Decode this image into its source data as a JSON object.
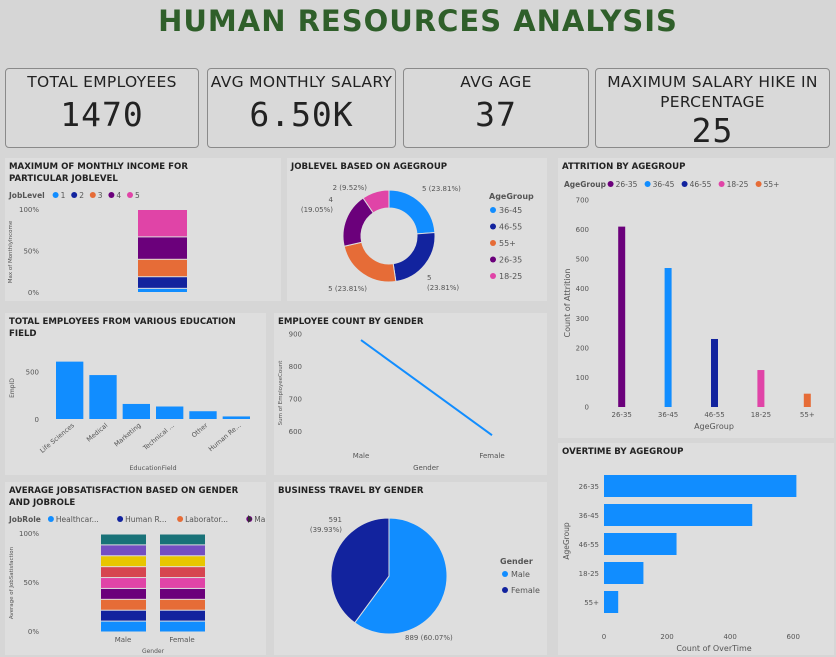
{
  "title": "HUMAN RESOURCES ANALYSIS",
  "kpis": {
    "total_employees": {
      "label": "TOTAL EMPLOYEES",
      "value": "1470"
    },
    "avg_salary": {
      "label": "AVG MONTHLY SALARY",
      "value": "6.50K"
    },
    "avg_age": {
      "label": "AVG AGE",
      "value": "37"
    },
    "max_hike": {
      "label": "MAXIMUM SALARY HIKE IN PERCENTAGE",
      "value": "25"
    }
  },
  "colors": {
    "c1": "#118dff",
    "c2": "#12239e",
    "c3": "#e66c37",
    "c4": "#6b007b",
    "c5": "#e044a7",
    "c6": "#d64550",
    "c7": "#e8c600",
    "c8": "#744ec2",
    "c9": "#197278"
  },
  "chart_data": [
    {
      "id": "jobincome",
      "type": "bar",
      "title": "MAXIMUM OF MONTHLY INCOME FOR PARTICULAR JOBLEVEL",
      "legend_title": "JobLevel",
      "categories": [
        ""
      ],
      "series": [
        {
          "name": "1",
          "values": [
            5
          ]
        },
        {
          "name": "2",
          "values": [
            14
          ]
        },
        {
          "name": "3",
          "values": [
            21
          ]
        },
        {
          "name": "4",
          "values": [
            27
          ]
        },
        {
          "name": "5",
          "values": [
            33
          ]
        }
      ],
      "ylabel": "Max of MonthlyIncome",
      "yticks": [
        "100%",
        "50%",
        "0%"
      ],
      "stacked": "100%"
    },
    {
      "id": "joblevel",
      "type": "pie",
      "variant": "donut",
      "title": "JOBLEVEL BASED ON AGEGROUP",
      "legend_title": "AgeGroup",
      "labels": [
        "36-45",
        "46-55",
        "55+",
        "26-35",
        "18-25"
      ],
      "values": [
        5,
        5,
        5,
        4,
        2
      ],
      "data_labels": [
        "5 (23.81%)",
        "5\n(23.81%)",
        "5 (23.81%)",
        "4\n(19.05%)",
        "2 (9.52%)"
      ]
    },
    {
      "id": "attrition",
      "type": "bar",
      "title": "ATTRITION BY AGEGROUP",
      "legend_title": "AgeGroup",
      "legend": [
        "26-35",
        "36-45",
        "46-55",
        "18-25",
        "55+"
      ],
      "categories": [
        "26-35",
        "36-45",
        "46-55",
        "18-25",
        "55+"
      ],
      "values": [
        610,
        470,
        230,
        125,
        45
      ],
      "xlabel": "AgeGroup",
      "ylabel": "Count of Attrition",
      "ylim": [
        0,
        700
      ],
      "yticks": [
        0,
        100,
        200,
        300,
        400,
        500,
        600,
        700
      ]
    },
    {
      "id": "education",
      "type": "bar",
      "title": "TOTAL EMPLOYEES FROM VARIOUS EDUCATION FIELD",
      "categories": [
        "Life Sciences",
        "Medical",
        "Marketing",
        "Technical ...",
        "Other",
        "Human Re..."
      ],
      "values": [
        606,
        464,
        159,
        132,
        82,
        27
      ],
      "xlabel": "EducationField",
      "ylabel": "EmpID",
      "ylim": [
        0,
        750
      ],
      "yticks": [
        0,
        500
      ]
    },
    {
      "id": "gender",
      "type": "line",
      "title": "EMPLOYEE COUNT BY GENDER",
      "categories": [
        "Male",
        "Female"
      ],
      "values": [
        882,
        588
      ],
      "xlabel": "Gender",
      "ylabel": "Sum of EmployeeCount",
      "ylim": [
        570,
        910
      ],
      "yticks": [
        600,
        700,
        800,
        900
      ]
    },
    {
      "id": "overtime",
      "type": "bar",
      "orientation": "horizontal",
      "title": "OVERTIME BY AGEGROUP",
      "categories": [
        "26-35",
        "36-45",
        "46-55",
        "18-25",
        "55+"
      ],
      "values": [
        610,
        470,
        230,
        125,
        45
      ],
      "xlabel": "Count of OverTime",
      "ylabel": "AgeGroup",
      "xlim": [
        0,
        650
      ],
      "xticks": [
        0,
        200,
        400,
        600
      ]
    },
    {
      "id": "jobsat",
      "type": "bar",
      "title": "AVERAGE JOBSATISFACTION BASED ON GENDER AND JOBROLE",
      "legend_title": "JobRole",
      "legend": [
        "Healthcar...",
        "Human R...",
        "Laborator...",
        "Manager"
      ],
      "categories": [
        "Male",
        "Female"
      ],
      "segments": 9,
      "xlabel": "Gender",
      "ylabel": "Average of JobSatisfaction",
      "yticks": [
        "100%",
        "50%",
        "0%"
      ],
      "stacked": "100%"
    },
    {
      "id": "travel",
      "type": "pie",
      "title": "BUSINESS TRAVEL BY GENDER",
      "legend_title": "Gender",
      "labels": [
        "Male",
        "Female"
      ],
      "values": [
        889,
        591
      ],
      "data_labels": [
        "889 (60.07%)",
        "591\n(39.93%)"
      ]
    }
  ]
}
